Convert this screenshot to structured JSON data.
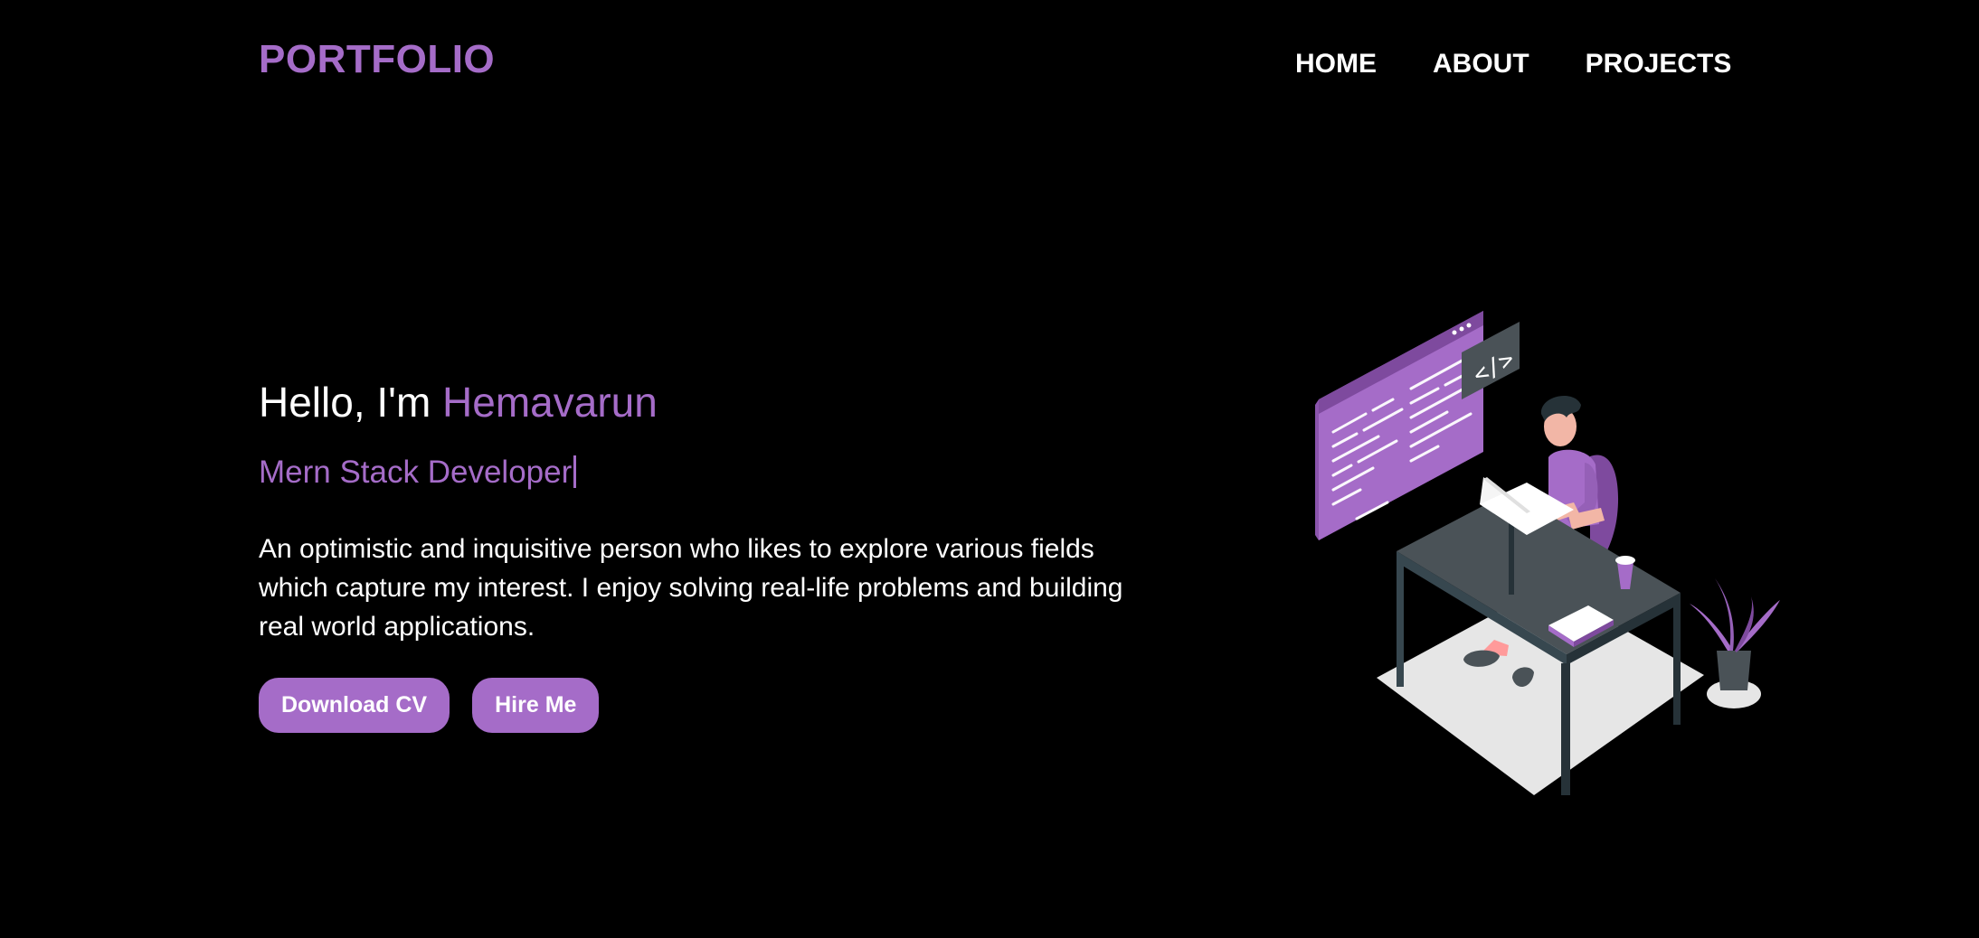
{
  "nav": {
    "brand": "PORTFOLIO",
    "links": [
      "HOME",
      "ABOUT",
      "PROJECTS"
    ]
  },
  "hero": {
    "greeting_prefix": "Hello, I'm ",
    "name": "Hemavarun",
    "role": "Mern Stack Developer",
    "description": "An optimistic and inquisitive person who likes to explore various fields which capture my interest. I enjoy solving real-life problems and building real world applications.",
    "buttons": {
      "download_cv": "Download CV",
      "hire_me": "Hire Me"
    },
    "code_symbol": "</>"
  },
  "colors": {
    "accent": "#a56cc8",
    "background": "#000000",
    "text": "#ffffff"
  },
  "icons": {
    "illustration": "developer-at-desk-illustration"
  }
}
